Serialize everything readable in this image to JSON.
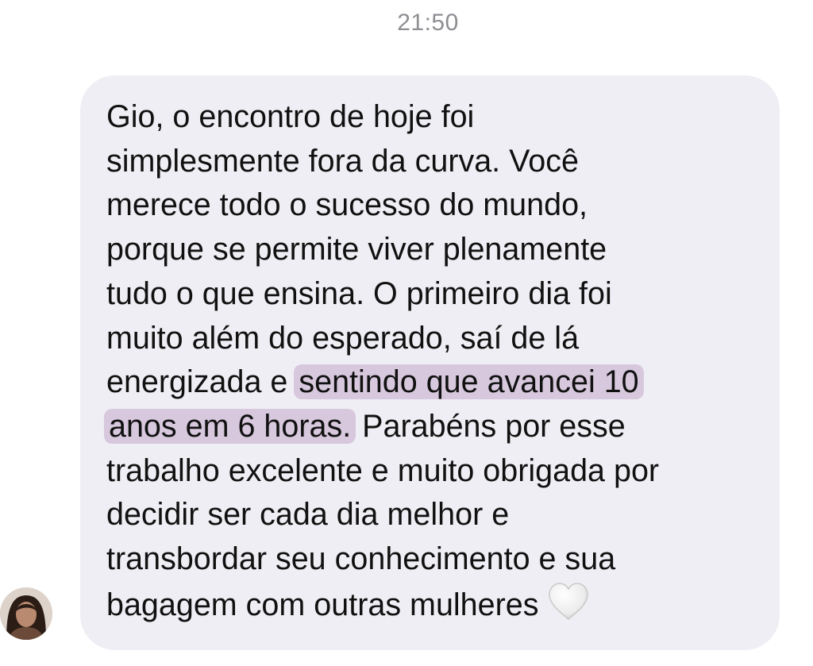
{
  "conversation": {
    "timestamp": "21:50"
  },
  "message": {
    "sender": "received",
    "bubble_color": "#efeef4",
    "highlight_color": "#d7c8dd",
    "lines": [
      {
        "before": "Gio, o encontro de hoje foi"
      },
      {
        "before": "simplesmente fora da curva. Você"
      },
      {
        "before": "merece todo o sucesso do mundo,"
      },
      {
        "before": "porque se permite viver plenamente"
      },
      {
        "before": "tudo o que ensina. O primeiro dia foi"
      },
      {
        "before": "muito além do esperado, saí de lá"
      },
      {
        "before": "energizada e ",
        "highlight": "sentindo que avancei 10"
      },
      {
        "highlight": "anos em 6 horas.",
        "after": " Parabéns por esse"
      },
      {
        "before": "trabalho excelente e muito obrigada por"
      },
      {
        "before": "decidir ser cada dia melhor e"
      },
      {
        "before": "transbordar seu conhecimento e sua"
      },
      {
        "before": "bagagem com outras mulheres"
      }
    ],
    "emoji": "white-heart-icon"
  },
  "avatar": {
    "icon": "contact-avatar"
  }
}
